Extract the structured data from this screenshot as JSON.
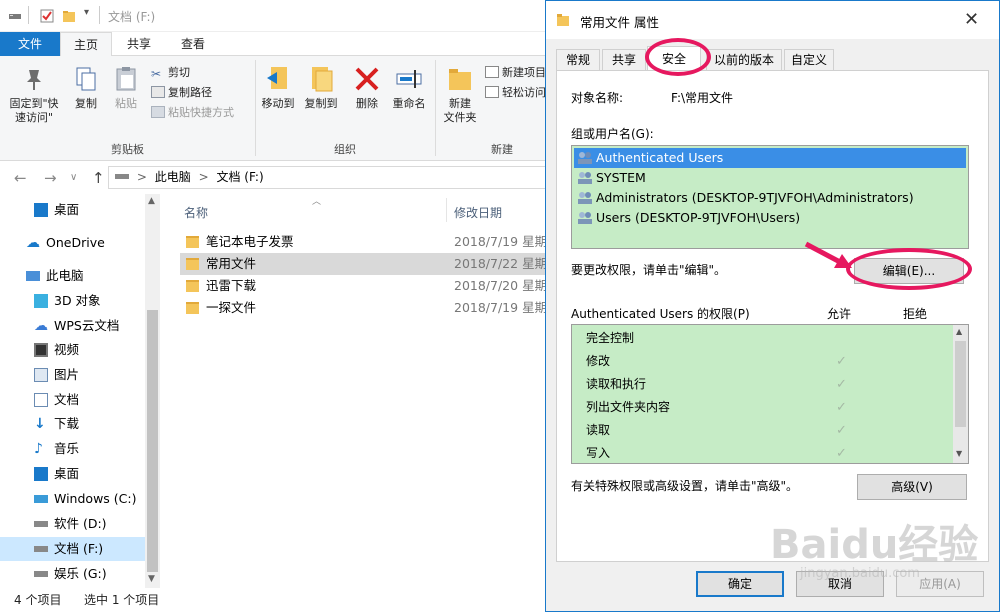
{
  "explorer": {
    "title": "文档 (F:)",
    "tabs": {
      "file": "文件",
      "home": "主页",
      "share": "共享",
      "view": "查看"
    },
    "clipboard": {
      "pin": "固定到\"快速访问\"",
      "copy": "复制",
      "paste": "粘贴",
      "cut": "剪切",
      "copy_path": "复制路径",
      "paste_shortcut": "粘贴快捷方式",
      "label": "剪贴板"
    },
    "organize": {
      "move_to": "移动到",
      "copy_to": "复制到",
      "delete": "删除",
      "rename": "重命名",
      "label": "组织"
    },
    "new": {
      "new_folder": "新建\n文件夹",
      "new_item": "新建项目",
      "easy_access": "轻松访问",
      "label": "新建"
    },
    "address": {
      "root": "此电脑",
      "current": "文档 (F:)",
      "sep": ">"
    },
    "nav": [
      "桌面",
      "OneDrive",
      "此电脑",
      "3D 对象",
      "WPS云文档",
      "视频",
      "图片",
      "文档",
      "下载",
      "音乐",
      "桌面",
      "Windows (C:)",
      "软件 (D:)",
      "文档 (F:)",
      "娱乐 (G:)"
    ],
    "columns": {
      "name": "名称",
      "modified": "修改日期"
    },
    "files": [
      {
        "name": "笔记本电子发票",
        "date": "2018/7/19 星期"
      },
      {
        "name": "常用文件",
        "date": "2018/7/22 星期"
      },
      {
        "name": "迅雷下载",
        "date": "2018/7/20 星期"
      },
      {
        "name": "一探文件",
        "date": "2018/7/19 星期"
      }
    ],
    "status": {
      "count": "4 个项目",
      "selected": "选中 1 个项目"
    }
  },
  "dialog": {
    "title": "常用文件 属性",
    "tabs": {
      "general": "常规",
      "sharing": "共享",
      "security": "安全",
      "previous": "以前的版本",
      "custom": "自定义"
    },
    "object_label": "对象名称:",
    "object_value": "F:\\常用文件",
    "groups_label": "组或用户名(G):",
    "users": [
      "Authenticated Users",
      "SYSTEM",
      "Administrators (DESKTOP-9TJVFOH\\Administrators)",
      "Users (DESKTOP-9TJVFOH\\Users)"
    ],
    "edit_hint": "要更改权限，请单击\"编辑\"。",
    "edit_button": "编辑(E)...",
    "perm_title": "Authenticated Users 的权限(P)",
    "allow": "允许",
    "deny": "拒绝",
    "permissions": [
      {
        "name": "完全控制",
        "allow": false
      },
      {
        "name": "修改",
        "allow": true
      },
      {
        "name": "读取和执行",
        "allow": true
      },
      {
        "name": "列出文件夹内容",
        "allow": true
      },
      {
        "name": "读取",
        "allow": true
      },
      {
        "name": "写入",
        "allow": true
      }
    ],
    "check_mark": "✓",
    "advanced_hint": "有关特殊权限或高级设置，请单击\"高级\"。",
    "advanced_button": "高级(V)",
    "ok": "确定",
    "cancel": "取消",
    "apply": "应用(A)"
  },
  "watermark": {
    "brand": "Baidu经验",
    "url": "jingyan.baidu.com"
  },
  "colors": {
    "accent": "#1979ca",
    "highlight": "#e6185f",
    "list_bg": "#c6ecc6"
  }
}
